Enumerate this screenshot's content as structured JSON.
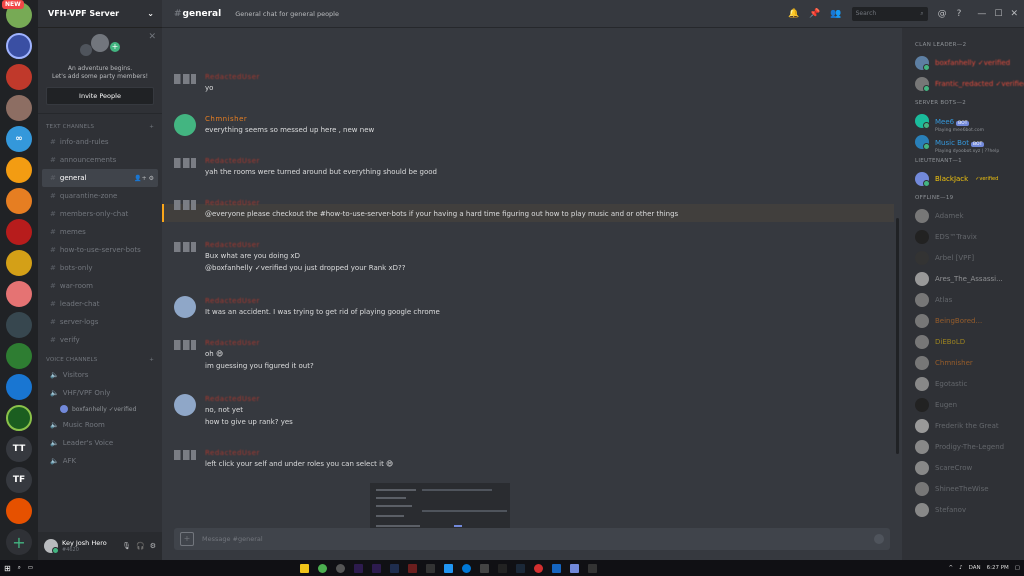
{
  "server": {
    "name": "VFH-VPF Server",
    "new_badge": "NEW"
  },
  "rail": {
    "items": [
      "TT",
      "TF",
      "+"
    ]
  },
  "invite": {
    "line1": "An adventure begins.",
    "line2": "Let's add some party members!",
    "button": "Invite People"
  },
  "text_category": "TEXT CHANNELS",
  "text_channels": [
    "info-and-rules",
    "announcements",
    "general",
    "quarantine-zone",
    "members-only-chat",
    "memes",
    "how-to-use-server-bots",
    "bots-only",
    "war-room",
    "leader-chat",
    "server-logs",
    "verify"
  ],
  "voice_category": "VOICE CHANNELS",
  "voice_channels": [
    "Visitors",
    "VHF/VPF Only",
    "Music Room",
    "Leader's Voice",
    "AFK"
  ],
  "voice_user": "boxfanhelly ✓verified",
  "user": {
    "name": "Key Josh Hero",
    "tag": "#4620"
  },
  "topbar": {
    "channel": "general",
    "topic": "General chat for general people",
    "search_placeholder": "Search"
  },
  "messages": [
    {
      "author": "RedactedUser",
      "lines": [
        "yo"
      ]
    },
    {
      "author": "Chmnisher",
      "lines": [
        "everything seems so messed up here , new new"
      ]
    },
    {
      "author": "RedactedUser",
      "lines": [
        "yah the rooms were turned around but everything should be good"
      ]
    },
    {
      "author": "RedactedUser",
      "lines": [
        "@everyone please checkout the #how-to-use-server-bots if your having a hard time figuring out how to play music and or other things"
      ]
    },
    {
      "author": "RedactedUser",
      "lines": [
        "Bux what are you doing xD",
        "@boxfanhelly ✓verified you just dropped your Rank xD??"
      ]
    },
    {
      "author": "RedactedUser",
      "lines": [
        "It was an accident. I was trying to get rid of playing google chrome"
      ]
    },
    {
      "author": "RedactedUser",
      "lines": [
        "oh 😄",
        "im guessing you figured it out?"
      ]
    },
    {
      "author": "RedactedUser",
      "lines": [
        "no, not yet",
        "how to give up rank?  yes"
      ]
    },
    {
      "author": "RedactedUser",
      "lines": [
        "left click your self and under roles you can select it 😄"
      ]
    }
  ],
  "composer": {
    "placeholder": "Message #general"
  },
  "members": {
    "clan_leader_cat": "CLAN LEADER—2",
    "clan_leaders": [
      "boxfanhelly ✓verified",
      "Frantic_redacted ✓verified"
    ],
    "server_bots_cat": "SERVER BOTS—2",
    "bots": [
      {
        "name": "Mee6",
        "badge": "BOT",
        "status": "Playing mee6bot.com"
      },
      {
        "name": "Music Bot",
        "badge": "BOT",
        "status": "Playing dyoobot.xyz | ??help"
      }
    ],
    "lieutenant_cat": "LIEUTENANT—1",
    "lieutenants": [
      {
        "name": "BlackJack",
        "verified": "✓verified"
      }
    ],
    "offline_cat": "OFFLINE—19",
    "offline": [
      "Adamek",
      "EDS™Travix",
      "Arbel [VPF]",
      "Ares_The_Assassi...",
      "Atlas",
      "BeingBored...",
      "DiEBoLD",
      "Chmnisher",
      "Egotastic",
      "Eugen",
      "Frederik the Great",
      "Prodigy-The-Legend",
      "ScareCrow",
      "ShineeTheWise",
      "Stefanov"
    ]
  },
  "taskbar": {
    "lang": "DAN",
    "time": "6:27 PM"
  },
  "colors": {
    "accent": "#7289da",
    "online": "#43b581",
    "bg": "#36393f"
  }
}
